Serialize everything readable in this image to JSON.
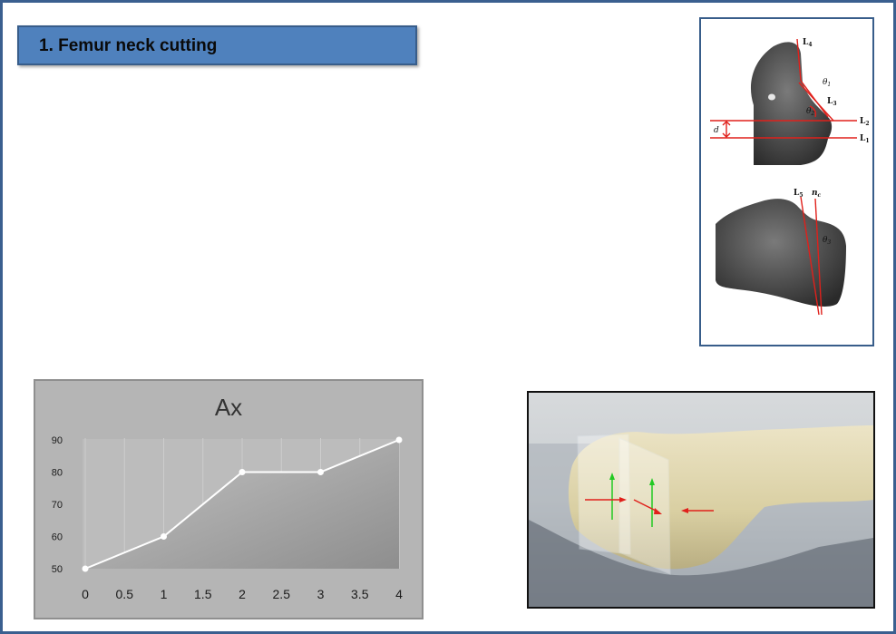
{
  "slide": {
    "title": "1. Femur neck cutting"
  },
  "figure": {
    "labels": {
      "L4": "L",
      "L4_sub": "4",
      "theta1": "θ",
      "theta1_sub": "1",
      "L3": "L",
      "L3_sub": "3",
      "theta2": "θ",
      "theta2_sub": "2",
      "L2": "L",
      "L2_sub": "2",
      "d": "d",
      "L1": "L",
      "L1_sub": "1",
      "L5": "L",
      "L5_sub": "5",
      "nc": "n",
      "nc_sub": "c",
      "theta3": "θ",
      "theta3_sub": "3"
    },
    "line_color": "#e0201b"
  },
  "chart_data": {
    "type": "line",
    "title": "Ax",
    "x": [
      0,
      1,
      2,
      3,
      4
    ],
    "values": [
      50,
      60,
      80,
      80,
      90
    ],
    "xticks": [
      "0",
      "0.5",
      "1",
      "1.5",
      "2",
      "2.5",
      "3",
      "3.5",
      "4"
    ],
    "yticks": [
      "50",
      "60",
      "70",
      "80",
      "90"
    ],
    "xlim": [
      0,
      4
    ],
    "ylim": [
      50,
      90
    ],
    "grid": true,
    "xlabel": "",
    "ylabel": ""
  }
}
